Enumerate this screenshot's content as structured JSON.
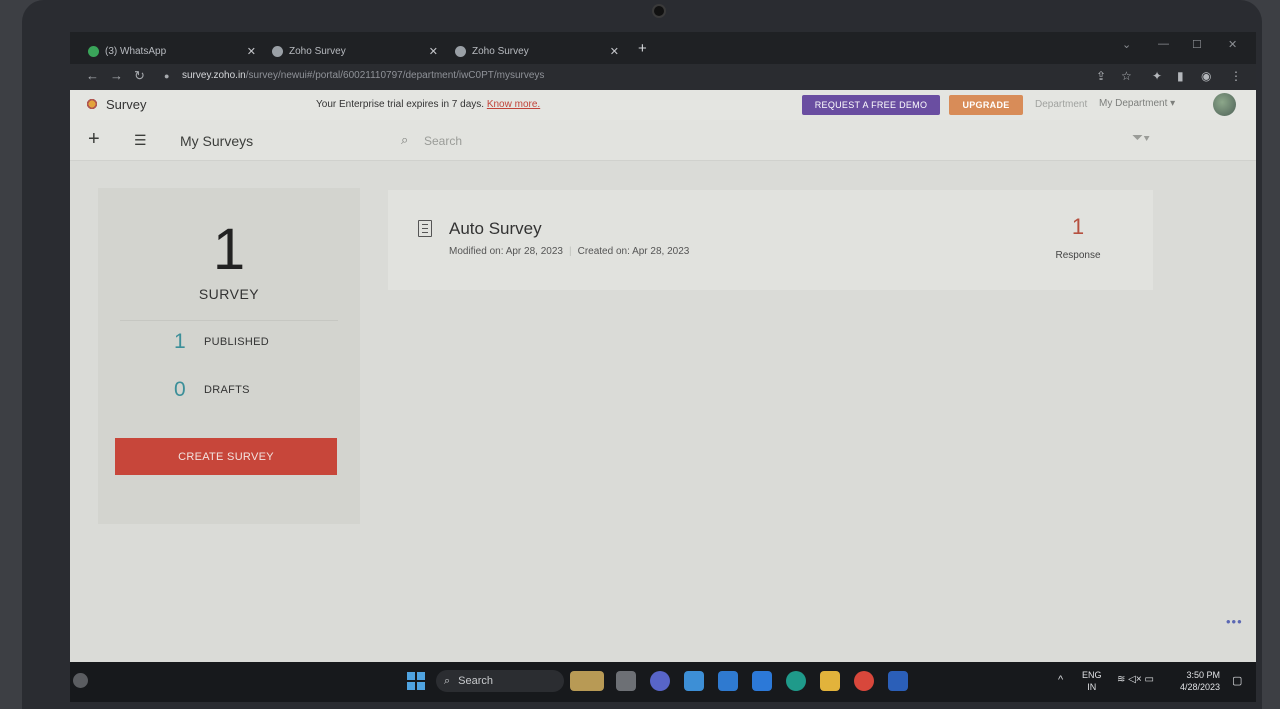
{
  "browser": {
    "tabs": [
      {
        "title": "(3) WhatsApp",
        "favicon_color": "#3aa55a"
      },
      {
        "title": "Zoho Survey",
        "favicon_color": "#9aa0a6"
      },
      {
        "title": "Zoho Survey",
        "favicon_color": "#9aa0a6"
      }
    ],
    "url_domain": "survey.zoho.in",
    "url_path": "/survey/newui#/portal/60021110797/department/iwC0PT/mysurveys"
  },
  "header": {
    "app_name": "Survey",
    "trial_text": "Your Enterprise trial expires in 7 days.",
    "trial_link": "Know more.",
    "demo_button": "REQUEST A FREE DEMO",
    "upgrade_button": "UPGRADE",
    "department_label": "Department",
    "department_value": "My Department ▾"
  },
  "toolbar": {
    "title": "My Surveys",
    "search_placeholder": "Search"
  },
  "summary": {
    "count": "1",
    "count_label": "SURVEY",
    "published_count": "1",
    "published_label": "PUBLISHED",
    "drafts_count": "0",
    "drafts_label": "DRAFTS",
    "create_button": "CREATE SURVEY"
  },
  "surveys": [
    {
      "title": "Auto Survey",
      "modified": "Modified on: Apr 28, 2023",
      "created": "Created on: Apr 28, 2023",
      "responses": "1",
      "response_label": "Response"
    }
  ],
  "taskbar": {
    "search_label": "Search",
    "lang_1": "ENG",
    "lang_2": "IN",
    "time": "3:50 PM",
    "date": "4/28/2023"
  },
  "colors": {
    "accent_red": "#c7463a",
    "demo_purple": "#6a4ea1",
    "upgrade_orange": "#d88c58",
    "count_teal": "#3c8f99"
  }
}
